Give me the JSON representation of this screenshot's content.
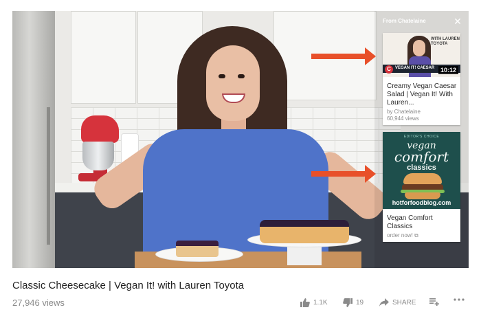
{
  "player": {
    "end_screen_heading": "From Chatelaine",
    "close_symbol": "✕"
  },
  "cards": [
    {
      "thumb_text": "WITH LAUREN TOYOTA",
      "thumb_bar_text": "VEGAN IT! CAESAR",
      "logo_letter": "C",
      "duration": "10:12",
      "title": "Creamy Vegan Caesar Salad | Vegan It! With Lauren...",
      "channel": "by Chatelaine",
      "views": "60,944 views"
    },
    {
      "book_top": "EDITOR'S CHOICE",
      "book_word1": "vegan",
      "book_word2": "comfort",
      "book_word3": "classics",
      "book_site": "hotforfoodblog.com",
      "title": "Vegan Comfort Classics",
      "cta": "order now! ⧉"
    }
  ],
  "video": {
    "title": "Classic Cheesecake | Vegan It! with Lauren Toyota",
    "views": "27,946 views"
  },
  "actions": {
    "likes": "1.1K",
    "dislikes": "19",
    "share_label": "SHARE"
  },
  "colors": {
    "arrow": "#e8502a",
    "shirt": "#4f73c9",
    "mixer": "#d6333c"
  }
}
